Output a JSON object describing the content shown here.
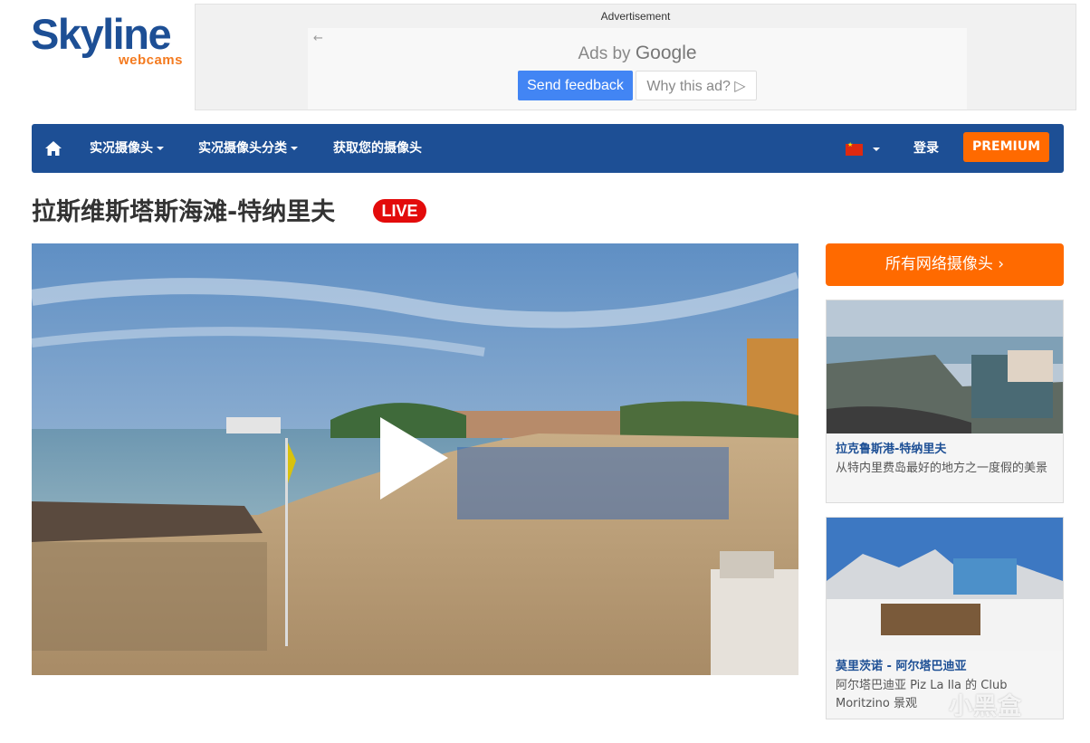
{
  "logo": {
    "main": "Skyline",
    "sub": "webcams"
  },
  "ad": {
    "label": "Advertisement",
    "back": "←",
    "ads_by": "Ads by",
    "google": "Google",
    "send_feedback": "Send feedback",
    "why_this_ad": "Why this ad? ▷"
  },
  "nav": {
    "live_cams": "实况摄像头",
    "categories": "实况摄像头分类",
    "get_webcam": "获取您的摄像头",
    "login": "登录",
    "premium": "PREMIUM"
  },
  "page": {
    "title": "拉斯维斯塔斯海滩-特纳里夫",
    "live_badge": "LIVE"
  },
  "sidebar": {
    "all_webcams": "所有网络摄像头 ›",
    "cards": [
      {
        "title": "拉克鲁斯港-特纳里夫",
        "desc": "从特内里费岛最好的地方之一度假的美景"
      },
      {
        "title": "莫里茨诺 - 阿尔塔巴迪亚",
        "desc": "阿尔塔巴迪亚 Piz La Ila 的 Club Moritzino 景观"
      }
    ]
  },
  "watermark": "小黑盒",
  "colors": {
    "brand_blue": "#1d4f95",
    "accent_orange": "#ff6a00",
    "live_red": "#e30b0b",
    "google_blue": "#4285f4"
  },
  "icons": [
    "home-icon",
    "caret-down-icon",
    "china-flag-icon",
    "play-icon",
    "chevron-right-icon"
  ]
}
